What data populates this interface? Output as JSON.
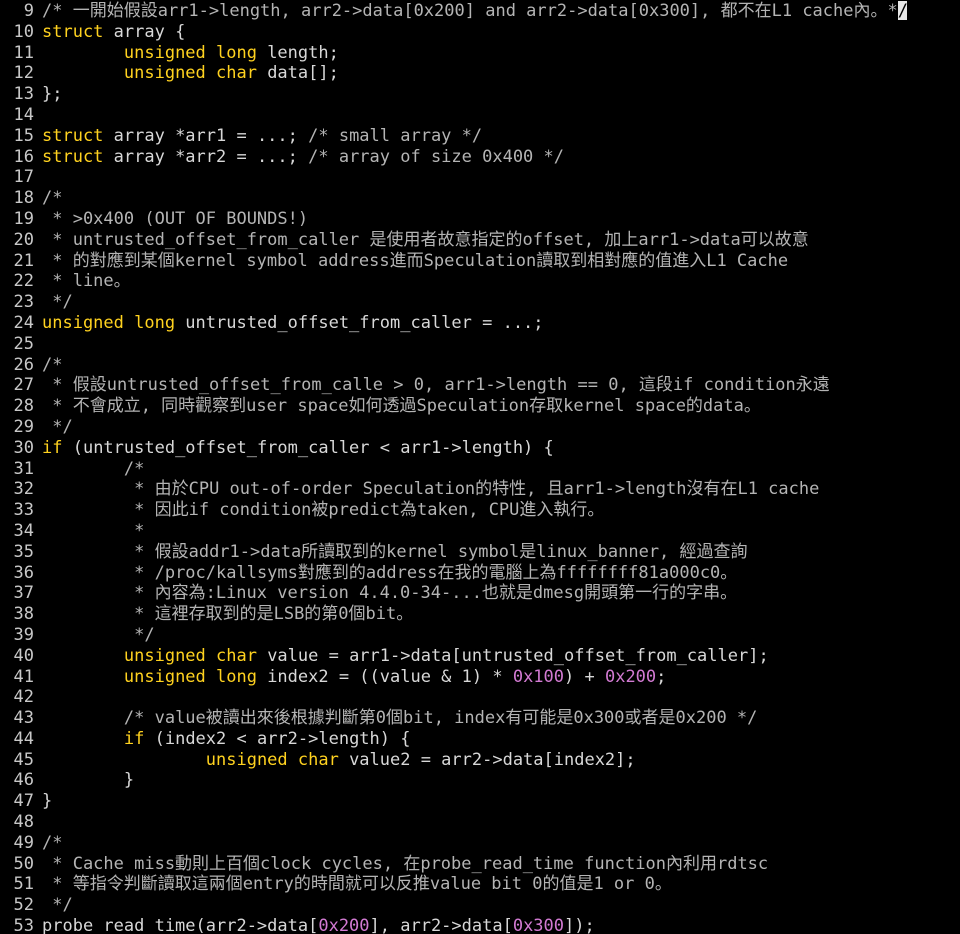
{
  "editor": {
    "colors": {
      "background": "#000000",
      "text": "#d8d8d8",
      "keyword": "#ffd21f",
      "comment": "#b4b4b4",
      "number": "#d27ad2",
      "line_number": "#c8c8c8"
    },
    "lines": [
      {
        "n": " 9",
        "segs": [
          {
            "t": "c",
            "v": "/* 一開始假設arr1->length, arr2->data[0x200] and arr2->data[0x300], 都不在L1 cache內。*"
          },
          {
            "t": "cursor",
            "v": "/"
          }
        ]
      },
      {
        "n": "10",
        "segs": [
          {
            "t": "k",
            "v": "struct"
          },
          {
            "t": "p",
            "v": " array {"
          }
        ]
      },
      {
        "n": "11",
        "segs": [
          {
            "t": "p",
            "v": "        "
          },
          {
            "t": "k",
            "v": "unsigned long"
          },
          {
            "t": "p",
            "v": " length;"
          }
        ]
      },
      {
        "n": "12",
        "segs": [
          {
            "t": "p",
            "v": "        "
          },
          {
            "t": "k",
            "v": "unsigned char"
          },
          {
            "t": "p",
            "v": " data[];"
          }
        ]
      },
      {
        "n": "13",
        "segs": [
          {
            "t": "p",
            "v": "};"
          }
        ]
      },
      {
        "n": "14",
        "segs": []
      },
      {
        "n": "15",
        "segs": [
          {
            "t": "k",
            "v": "struct"
          },
          {
            "t": "p",
            "v": " array *arr1 = ...; "
          },
          {
            "t": "c",
            "v": "/* small array */"
          }
        ]
      },
      {
        "n": "16",
        "segs": [
          {
            "t": "k",
            "v": "struct"
          },
          {
            "t": "p",
            "v": " array *arr2 = ...; "
          },
          {
            "t": "c",
            "v": "/* array of size 0x400 */"
          }
        ]
      },
      {
        "n": "17",
        "segs": []
      },
      {
        "n": "18",
        "segs": [
          {
            "t": "c",
            "v": "/*"
          }
        ]
      },
      {
        "n": "19",
        "segs": [
          {
            "t": "c",
            "v": " * >0x400 (OUT OF BOUNDS!)"
          }
        ]
      },
      {
        "n": "20",
        "segs": [
          {
            "t": "c",
            "v": " * untrusted_offset_from_caller 是使用者故意指定的offset, 加上arr1->data可以故意"
          }
        ]
      },
      {
        "n": "21",
        "segs": [
          {
            "t": "c",
            "v": " * 的對應到某個kernel symbol address進而Speculation讀取到相對應的值進入L1 Cache"
          }
        ]
      },
      {
        "n": "22",
        "segs": [
          {
            "t": "c",
            "v": " * line。"
          }
        ]
      },
      {
        "n": "23",
        "segs": [
          {
            "t": "c",
            "v": " */"
          }
        ]
      },
      {
        "n": "24",
        "segs": [
          {
            "t": "k",
            "v": "unsigned long"
          },
          {
            "t": "p",
            "v": " untrusted_offset_from_caller = ...;"
          }
        ]
      },
      {
        "n": "25",
        "segs": []
      },
      {
        "n": "26",
        "segs": [
          {
            "t": "c",
            "v": "/*"
          }
        ]
      },
      {
        "n": "27",
        "segs": [
          {
            "t": "c",
            "v": " * 假設untrusted_offset_from_calle > 0, arr1->length == 0, 這段if condition永遠"
          }
        ]
      },
      {
        "n": "28",
        "segs": [
          {
            "t": "c",
            "v": " * 不會成立, 同時觀察到user space如何透過Speculation存取kernel space的data。"
          }
        ]
      },
      {
        "n": "29",
        "segs": [
          {
            "t": "c",
            "v": " */"
          }
        ]
      },
      {
        "n": "30",
        "segs": [
          {
            "t": "k",
            "v": "if"
          },
          {
            "t": "p",
            "v": " (untrusted_offset_from_caller < arr1->length) {"
          }
        ]
      },
      {
        "n": "31",
        "segs": [
          {
            "t": "p",
            "v": "        "
          },
          {
            "t": "c",
            "v": "/*"
          }
        ]
      },
      {
        "n": "32",
        "segs": [
          {
            "t": "p",
            "v": "        "
          },
          {
            "t": "c",
            "v": " * 由於CPU out-of-order Speculation的特性, 且arr1->length沒有在L1 cache"
          }
        ]
      },
      {
        "n": "33",
        "segs": [
          {
            "t": "p",
            "v": "        "
          },
          {
            "t": "c",
            "v": " * 因此if condition被predict為taken, CPU進入執行。"
          }
        ]
      },
      {
        "n": "34",
        "segs": [
          {
            "t": "p",
            "v": "        "
          },
          {
            "t": "c",
            "v": " *"
          }
        ]
      },
      {
        "n": "35",
        "segs": [
          {
            "t": "p",
            "v": "        "
          },
          {
            "t": "c",
            "v": " * 假設addr1->data所讀取到的kernel symbol是linux_banner, 經過查詢"
          }
        ]
      },
      {
        "n": "36",
        "segs": [
          {
            "t": "p",
            "v": "        "
          },
          {
            "t": "c",
            "v": " * /proc/kallsyms對應到的address在我的電腦上為ffffffff81a000c0。"
          }
        ]
      },
      {
        "n": "37",
        "segs": [
          {
            "t": "p",
            "v": "        "
          },
          {
            "t": "c",
            "v": " * 內容為:Linux version 4.4.0-34-...也就是dmesg開頭第一行的字串。"
          }
        ]
      },
      {
        "n": "38",
        "segs": [
          {
            "t": "p",
            "v": "        "
          },
          {
            "t": "c",
            "v": " * 這裡存取到的是LSB的第0個bit。"
          }
        ]
      },
      {
        "n": "39",
        "segs": [
          {
            "t": "p",
            "v": "        "
          },
          {
            "t": "c",
            "v": " */"
          }
        ]
      },
      {
        "n": "40",
        "segs": [
          {
            "t": "p",
            "v": "        "
          },
          {
            "t": "k",
            "v": "unsigned char"
          },
          {
            "t": "p",
            "v": " value = arr1->data[untrusted_offset_from_caller];"
          }
        ]
      },
      {
        "n": "41",
        "segs": [
          {
            "t": "p",
            "v": "        "
          },
          {
            "t": "k",
            "v": "unsigned long"
          },
          {
            "t": "p",
            "v": " index2 = ((value & 1) * "
          },
          {
            "t": "n",
            "v": "0x100"
          },
          {
            "t": "p",
            "v": ") + "
          },
          {
            "t": "n",
            "v": "0x200"
          },
          {
            "t": "p",
            "v": ";"
          }
        ]
      },
      {
        "n": "42",
        "segs": []
      },
      {
        "n": "43",
        "segs": [
          {
            "t": "p",
            "v": "        "
          },
          {
            "t": "c",
            "v": "/* value被讀出來後根據判斷第0個bit, index有可能是0x300或者是0x200 */"
          }
        ]
      },
      {
        "n": "44",
        "segs": [
          {
            "t": "p",
            "v": "        "
          },
          {
            "t": "k",
            "v": "if"
          },
          {
            "t": "p",
            "v": " (index2 < arr2->length) {"
          }
        ]
      },
      {
        "n": "45",
        "segs": [
          {
            "t": "p",
            "v": "                "
          },
          {
            "t": "k",
            "v": "unsigned char"
          },
          {
            "t": "p",
            "v": " value2 = arr2->data[index2];"
          }
        ]
      },
      {
        "n": "46",
        "segs": [
          {
            "t": "p",
            "v": "        }"
          }
        ]
      },
      {
        "n": "47",
        "segs": [
          {
            "t": "p",
            "v": "}"
          }
        ]
      },
      {
        "n": "48",
        "segs": []
      },
      {
        "n": "49",
        "segs": [
          {
            "t": "c",
            "v": "/*"
          }
        ]
      },
      {
        "n": "50",
        "segs": [
          {
            "t": "c",
            "v": " * Cache miss動則上百個clock cycles, 在probe_read_time function內利用rdtsc"
          }
        ]
      },
      {
        "n": "51",
        "segs": [
          {
            "t": "c",
            "v": " * 等指令判斷讀取這兩個entry的時間就可以反推value bit 0的值是1 or 0。"
          }
        ]
      },
      {
        "n": "52",
        "segs": [
          {
            "t": "c",
            "v": " */"
          }
        ]
      },
      {
        "n": "53",
        "segs": [
          {
            "t": "p",
            "v": "probe_read_time(arr2->data["
          },
          {
            "t": "n",
            "v": "0x200"
          },
          {
            "t": "p",
            "v": "], arr2->data["
          },
          {
            "t": "n",
            "v": "0x300"
          },
          {
            "t": "p",
            "v": "]);"
          }
        ]
      }
    ]
  }
}
